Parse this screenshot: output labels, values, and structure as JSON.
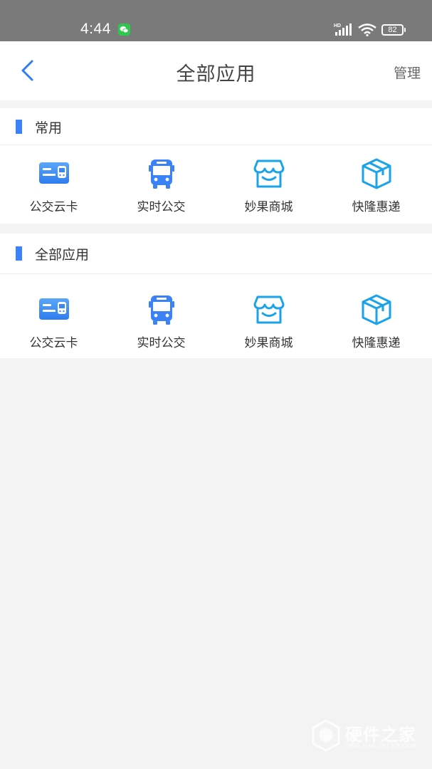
{
  "status_bar": {
    "time": "4:44",
    "battery": "82",
    "network": "HD"
  },
  "header": {
    "title": "全部应用",
    "manage_label": "管理"
  },
  "sections": [
    {
      "title": "常用",
      "apps": [
        {
          "label": "公交云卡",
          "icon": "bus-card-icon"
        },
        {
          "label": "实时公交",
          "icon": "bus-icon"
        },
        {
          "label": "妙果商城",
          "icon": "store-icon"
        },
        {
          "label": "快隆惠递",
          "icon": "package-icon"
        }
      ]
    },
    {
      "title": "全部应用",
      "apps": [
        {
          "label": "公交云卡",
          "icon": "bus-card-icon"
        },
        {
          "label": "实时公交",
          "icon": "bus-icon"
        },
        {
          "label": "妙果商城",
          "icon": "store-icon"
        },
        {
          "label": "快隆惠递",
          "icon": "package-icon"
        }
      ]
    }
  ],
  "watermark": {
    "text": "硬件之家",
    "sub": "YING JIAN ZHI JIA.COM"
  },
  "colors": {
    "accent": "#3b82f6",
    "background": "#f3f3f3",
    "status_bar": "#7a7a7a"
  }
}
